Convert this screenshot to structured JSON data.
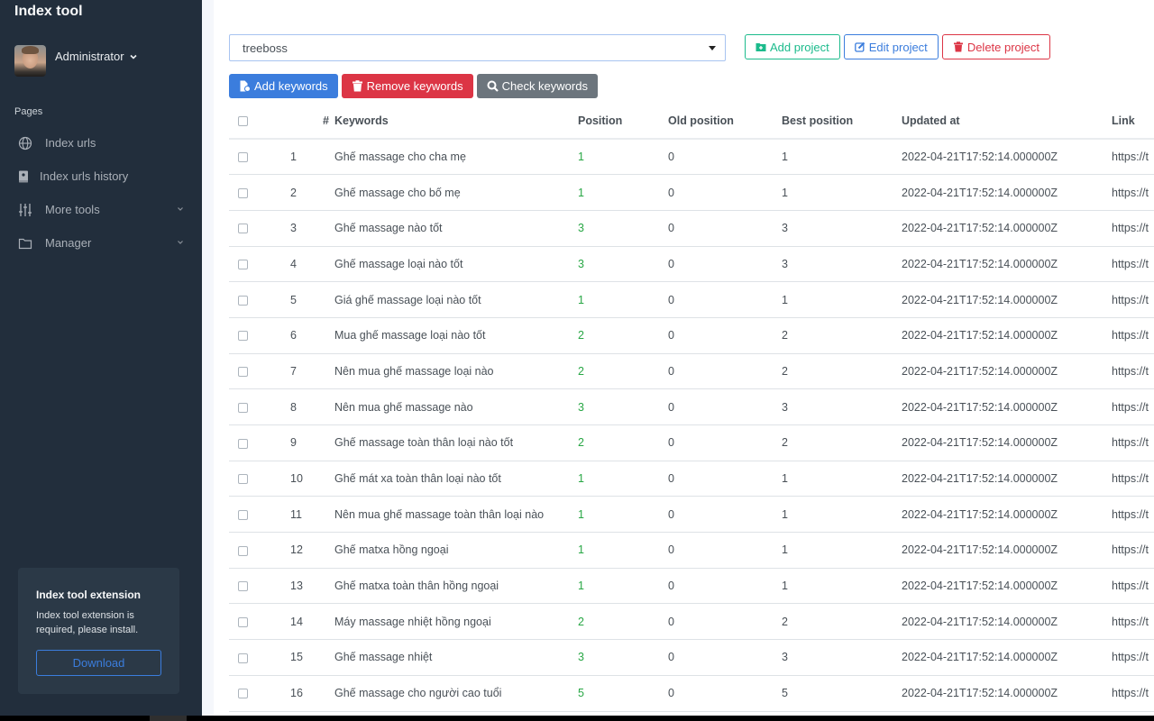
{
  "app": {
    "title": "Index tool"
  },
  "user": {
    "name": "Administrator"
  },
  "sidebar": {
    "section_title": "Pages",
    "items": [
      {
        "label": "Index urls",
        "icon": "globe-icon",
        "has_submenu": false
      },
      {
        "label": "Index urls history",
        "icon": "book-icon",
        "has_submenu": false
      },
      {
        "label": "More tools",
        "icon": "sliders-icon",
        "has_submenu": true
      },
      {
        "label": "Manager",
        "icon": "folder-icon",
        "has_submenu": true
      }
    ],
    "extension_card": {
      "title": "Index tool extension",
      "text": "Index tool extension is required, please install.",
      "button_label": "Download"
    }
  },
  "project_select": {
    "value": "treeboss"
  },
  "project_buttons": {
    "add": "Add project",
    "edit": "Edit project",
    "delete": "Delete project"
  },
  "keyword_buttons": {
    "add": "Add keywords",
    "remove": "Remove keywords",
    "check": "Check keywords"
  },
  "colors": {
    "sidebar_bg": "#222e3c",
    "primary": "#3b7ddd",
    "success": "#1cbb8c",
    "danger": "#dc3545",
    "secondary": "#6c757d",
    "position_text": "#28a745"
  },
  "table": {
    "headers": [
      "#",
      "Keywords",
      "Position",
      "Old position",
      "Best position",
      "Updated at",
      "Link"
    ],
    "rows": [
      {
        "num": "1",
        "keyword": "Ghế massage cho cha mẹ",
        "position": "1",
        "old_position": "0",
        "best_position": "1",
        "updated_at": "2022-04-21T17:52:14.000000Z",
        "link": "https://t"
      },
      {
        "num": "2",
        "keyword": "Ghế massage cho bố mẹ",
        "position": "1",
        "old_position": "0",
        "best_position": "1",
        "updated_at": "2022-04-21T17:52:14.000000Z",
        "link": "https://t"
      },
      {
        "num": "3",
        "keyword": "Ghế massage nào tốt",
        "position": "3",
        "old_position": "0",
        "best_position": "3",
        "updated_at": "2022-04-21T17:52:14.000000Z",
        "link": "https://t"
      },
      {
        "num": "4",
        "keyword": "Ghế massage loại nào tốt",
        "position": "3",
        "old_position": "0",
        "best_position": "3",
        "updated_at": "2022-04-21T17:52:14.000000Z",
        "link": "https://t"
      },
      {
        "num": "5",
        "keyword": "Giá ghế massage loại nào tốt",
        "position": "1",
        "old_position": "0",
        "best_position": "1",
        "updated_at": "2022-04-21T17:52:14.000000Z",
        "link": "https://t"
      },
      {
        "num": "6",
        "keyword": "Mua ghế massage loại nào tốt",
        "position": "2",
        "old_position": "0",
        "best_position": "2",
        "updated_at": "2022-04-21T17:52:14.000000Z",
        "link": "https://t"
      },
      {
        "num": "7",
        "keyword": "Nên mua ghế massage loại nào",
        "position": "2",
        "old_position": "0",
        "best_position": "2",
        "updated_at": "2022-04-21T17:52:14.000000Z",
        "link": "https://t"
      },
      {
        "num": "8",
        "keyword": "Nên mua ghế massage nào",
        "position": "3",
        "old_position": "0",
        "best_position": "3",
        "updated_at": "2022-04-21T17:52:14.000000Z",
        "link": "https://t"
      },
      {
        "num": "9",
        "keyword": "Ghế massage toàn thân loại nào tốt",
        "position": "2",
        "old_position": "0",
        "best_position": "2",
        "updated_at": "2022-04-21T17:52:14.000000Z",
        "link": "https://t"
      },
      {
        "num": "10",
        "keyword": "Ghế mát xa toàn thân loại nào tốt",
        "position": "1",
        "old_position": "0",
        "best_position": "1",
        "updated_at": "2022-04-21T17:52:14.000000Z",
        "link": "https://t"
      },
      {
        "num": "11",
        "keyword": "Nên mua ghế massage toàn thân loại nào",
        "position": "1",
        "old_position": "0",
        "best_position": "1",
        "updated_at": "2022-04-21T17:52:14.000000Z",
        "link": "https://t"
      },
      {
        "num": "12",
        "keyword": "Ghế matxa hồng ngoại",
        "position": "1",
        "old_position": "0",
        "best_position": "1",
        "updated_at": "2022-04-21T17:52:14.000000Z",
        "link": "https://t"
      },
      {
        "num": "13",
        "keyword": "Ghế matxa toàn thân hồng ngoại",
        "position": "1",
        "old_position": "0",
        "best_position": "1",
        "updated_at": "2022-04-21T17:52:14.000000Z",
        "link": "https://t"
      },
      {
        "num": "14",
        "keyword": "Máy massage nhiệt hồng ngoại",
        "position": "2",
        "old_position": "0",
        "best_position": "2",
        "updated_at": "2022-04-21T17:52:14.000000Z",
        "link": "https://t"
      },
      {
        "num": "15",
        "keyword": "Ghế massage nhiệt",
        "position": "3",
        "old_position": "0",
        "best_position": "3",
        "updated_at": "2022-04-21T17:52:14.000000Z",
        "link": "https://t"
      },
      {
        "num": "16",
        "keyword": "Ghế massage cho người cao tuổi",
        "position": "5",
        "old_position": "0",
        "best_position": "5",
        "updated_at": "2022-04-21T17:52:14.000000Z",
        "link": "https://t"
      }
    ]
  }
}
